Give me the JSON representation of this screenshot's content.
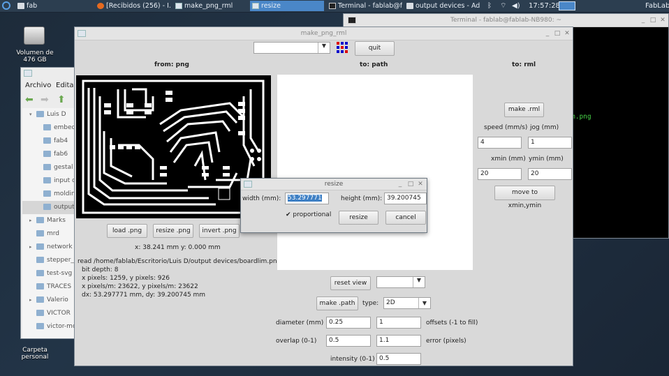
{
  "taskbar": {
    "items": [
      {
        "label": "fab",
        "icon": "folder-icon"
      },
      {
        "label": "[Recibidos (256) - I...",
        "icon": "firefox-icon"
      },
      {
        "label": "make_png_rml",
        "icon": "window-icon"
      },
      {
        "label": "resize",
        "icon": "window-icon",
        "active": true
      },
      {
        "label": "Terminal - fablab@f...",
        "icon": "terminal-icon"
      },
      {
        "label": "output devices - Ad...",
        "icon": "folder-icon"
      }
    ],
    "clock": "17:57:28",
    "user": "FabLab"
  },
  "desktop": {
    "drive_label_1": "Volumen de",
    "drive_label_2": "476 GB",
    "home_label_1": "Carpeta",
    "home_label_2": "personal"
  },
  "filemanager": {
    "menu": [
      "Archivo",
      "Editar"
    ],
    "items": [
      {
        "label": "Luis D",
        "arrow": "▾"
      },
      {
        "label": "embed",
        "arrow": ""
      },
      {
        "label": "fab4",
        "arrow": ""
      },
      {
        "label": "fab6",
        "arrow": ""
      },
      {
        "label": "gestal",
        "arrow": ""
      },
      {
        "label": "input d",
        "arrow": ""
      },
      {
        "label": "moldin",
        "arrow": ""
      },
      {
        "label": "output",
        "arrow": ""
      },
      {
        "label": "Marks",
        "arrow": "▸"
      },
      {
        "label": "mrd",
        "arrow": ""
      },
      {
        "label": "network",
        "arrow": "▸"
      },
      {
        "label": "stepper_",
        "arrow": ""
      },
      {
        "label": "test-svg",
        "arrow": ""
      },
      {
        "label": "TRACES",
        "arrow": ""
      },
      {
        "label": "Valerio",
        "arrow": "▸"
      },
      {
        "label": "VICTOR",
        "arrow": ""
      },
      {
        "label": "victor-mo",
        "arrow": ""
      }
    ]
  },
  "terminal": {
    "title": "Terminal - fablab@fablab-NB980: ~",
    "line": "m.png"
  },
  "main": {
    "title": "make_png_rml",
    "quit_label": "quit",
    "headings": {
      "from": "from: png",
      "to_path": "to: path",
      "to_rml": "to: rml"
    },
    "buttons": {
      "load": "load .png",
      "resize": "resize .png",
      "invert": "invert .png",
      "reset_view": "reset view",
      "make_path": "make .path",
      "make_rml": "make .rml",
      "move": "move to xmin,ymin"
    },
    "coords": "x: 38.241 mm  y: 0.000 mm",
    "info": [
      "read /home/fablab/Escritorio/Luis D/output devices/boardlim.png",
      "bit depth: 8",
      "x pixels: 1259, y pixels: 926",
      "x pixels/m: 23622, y pixels/m: 23622",
      "dx: 53.297771 mm, dy: 39.200745 mm"
    ],
    "type_label": "type:",
    "type_value": "2D",
    "diameter_label": "diameter (mm)",
    "diameter_value": "0.25",
    "offsets_value": "1",
    "offsets_label": "offsets (-1 to fill)",
    "overlap_label": "overlap (0-1)",
    "overlap_value": "0.5",
    "error_value": "1.1",
    "error_label": "error (pixels)",
    "intensity_label": "intensity (0-1)",
    "intensity_value": "0.5",
    "speed_label": "speed (mm/s)",
    "jog_label": "jog (mm)",
    "speed_value": "4",
    "jog_value": "1",
    "xmin_label": "xmin (mm)",
    "ymin_label": "ymin (mm)",
    "xmin_value": "20",
    "ymin_value": "20"
  },
  "resize_dialog": {
    "title": "resize",
    "width_label": "width (mm):",
    "width_value": "53.297771",
    "height_label": "height (mm):",
    "height_value": "39.200745",
    "proportional_label": "proportional",
    "proportional_checked": true,
    "resize_label": "resize",
    "cancel_label": "cancel"
  }
}
